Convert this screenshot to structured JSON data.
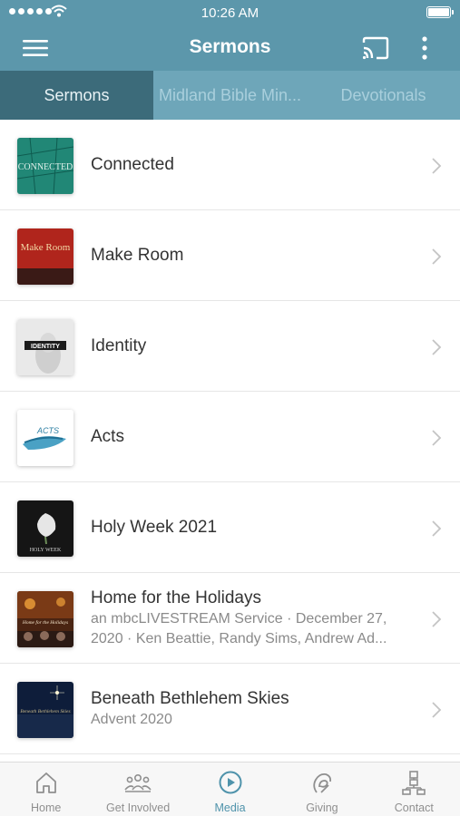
{
  "status_bar": {
    "time": "10:26 AM"
  },
  "app_bar": {
    "title": "Sermons"
  },
  "tabs": [
    {
      "label": "Sermons",
      "active": true
    },
    {
      "label": "Midland Bible Min...",
      "active": false
    },
    {
      "label": "Devotionals",
      "active": false
    }
  ],
  "sermons": [
    {
      "title": "Connected",
      "subtitle": "",
      "thumb_text": "CONNECTED"
    },
    {
      "title": "Make Room",
      "subtitle": "",
      "thumb_text": "Make Room"
    },
    {
      "title": "Identity",
      "subtitle": "",
      "thumb_text": "IDENTITY"
    },
    {
      "title": "Acts",
      "subtitle": "",
      "thumb_text": "ACTS"
    },
    {
      "title": "Holy Week 2021",
      "subtitle": "",
      "thumb_text": "HOLY WEEK"
    },
    {
      "title": "Home for the Holidays",
      "subtitle": "an mbcLIVESTREAM Service · December 27, 2020 · Ken Beattie, Randy Sims, Andrew Ad...",
      "thumb_text": "Home for the Holidays"
    },
    {
      "title": "Beneath Bethlehem Skies",
      "subtitle": "Advent 2020",
      "thumb_text": "Beneath Bethlehem Skies"
    }
  ],
  "bottom_nav": [
    {
      "label": "Home",
      "icon": "home-icon",
      "active": false
    },
    {
      "label": "Get Involved",
      "icon": "people-icon",
      "active": false
    },
    {
      "label": "Media",
      "icon": "play-circle-icon",
      "active": true
    },
    {
      "label": "Giving",
      "icon": "giving-icon",
      "active": false
    },
    {
      "label": "Contact",
      "icon": "org-chart-icon",
      "active": false
    }
  ],
  "colors": {
    "header": "#5c97ab",
    "tab_bar": "#6ea6b9",
    "tab_active": "#3c6b7a",
    "nav_active": "#4f93ab"
  }
}
